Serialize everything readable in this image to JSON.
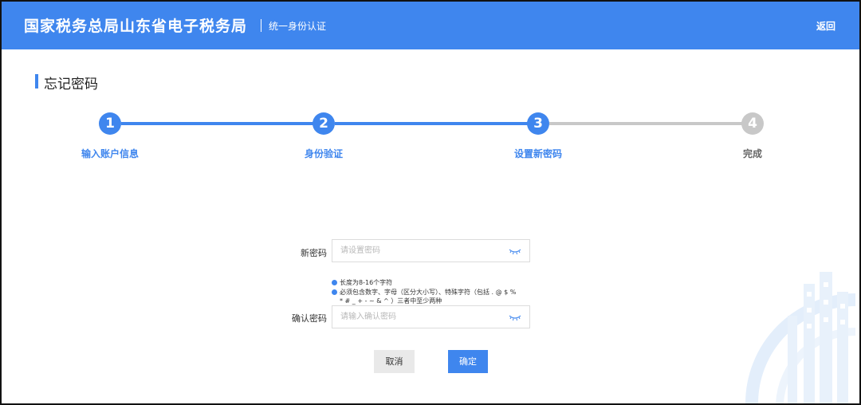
{
  "header": {
    "brand": "国家税务总局山东省电子税务局",
    "subtitle": "统一身份认证",
    "back_label": "返回"
  },
  "page": {
    "title": "忘记密码"
  },
  "steps": [
    {
      "number": "1",
      "label": "输入账户信息",
      "state": "done"
    },
    {
      "number": "2",
      "label": "身份验证",
      "state": "done"
    },
    {
      "number": "3",
      "label": "设置新密码",
      "state": "current"
    },
    {
      "number": "4",
      "label": "完成",
      "state": "pending"
    }
  ],
  "form": {
    "new_password": {
      "label": "新密码",
      "placeholder": "请设置密码",
      "value": ""
    },
    "hints": [
      "长度为8-16个字符",
      "必须包含数字、字母（区分大小写）、特殊字符（包括 . @ $ %",
      "* # _ + - ~ & ^ ）三者中至少两种"
    ],
    "confirm_password": {
      "label": "确认密码",
      "placeholder": "请输入确认密码",
      "value": ""
    }
  },
  "buttons": {
    "cancel": "取消",
    "confirm": "确定"
  },
  "colors": {
    "primary": "#3f86ee",
    "inactive": "#c8c8c8"
  },
  "icons": {
    "password_toggle": "eye-closed-icon",
    "watermark": "building-emblem-icon"
  }
}
